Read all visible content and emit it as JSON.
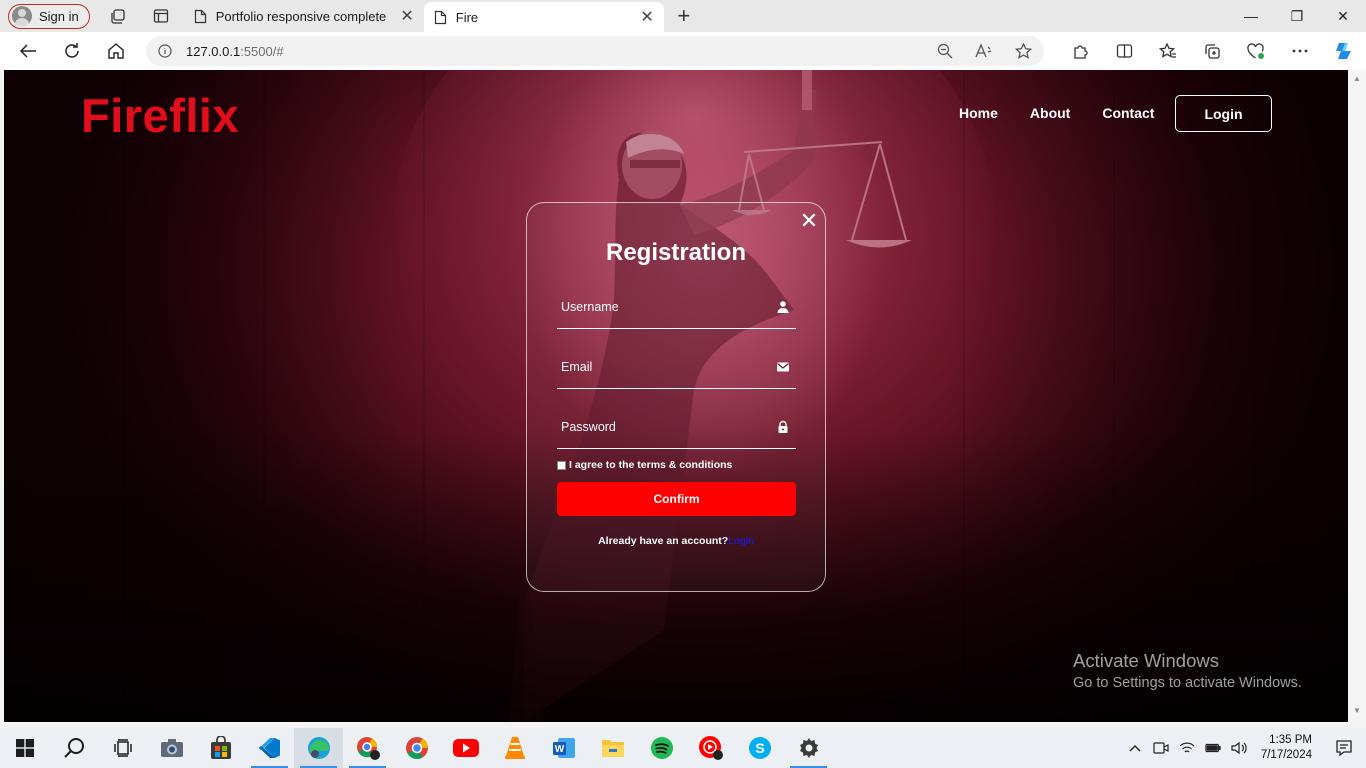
{
  "browser": {
    "profile_label": "Sign in",
    "tabs": [
      {
        "title": "Portfolio responsive complete",
        "close": "✕"
      },
      {
        "title": "Fire",
        "close": "✕"
      }
    ],
    "new_tab": "+",
    "window_controls": {
      "minimize": "—",
      "maximize": "❐",
      "close": "✕"
    },
    "address": {
      "host": "127.0.0.1",
      "rest": ":5500/#"
    }
  },
  "page": {
    "logo": "Fireflix",
    "nav": {
      "home": "Home",
      "about": "About",
      "contact": "Contact",
      "login": "Login"
    },
    "modal": {
      "close": "✕",
      "title": "Registration",
      "username_placeholder": "Username",
      "email_placeholder": "Email",
      "password_placeholder": "Password",
      "agree_text": "I agree to the terms & conditions",
      "confirm": "Confirm",
      "switch_text": "Already have an account?",
      "switch_link": "Login"
    },
    "watermark": {
      "line1": "Activate Windows",
      "line2": "Go to Settings to activate Windows."
    }
  },
  "colors": {
    "brand_red": "#e30e1b",
    "confirm_red": "#ff0000",
    "link_blue": "#1a1aff",
    "background_dark": "#140104"
  },
  "taskbar": {
    "apps": [
      "start-icon",
      "search-icon",
      "task-view-icon",
      "camera-icon",
      "store-icon",
      "vscode-icon",
      "edge-icon",
      "chrome-profile-icon",
      "chrome-icon",
      "youtube-icon",
      "vlc-icon",
      "word-icon",
      "file-explorer-icon",
      "spotify-icon",
      "youtube-music-icon",
      "skype-icon",
      "settings-icon"
    ],
    "time": "1:35 PM",
    "date": "7/17/2024"
  }
}
